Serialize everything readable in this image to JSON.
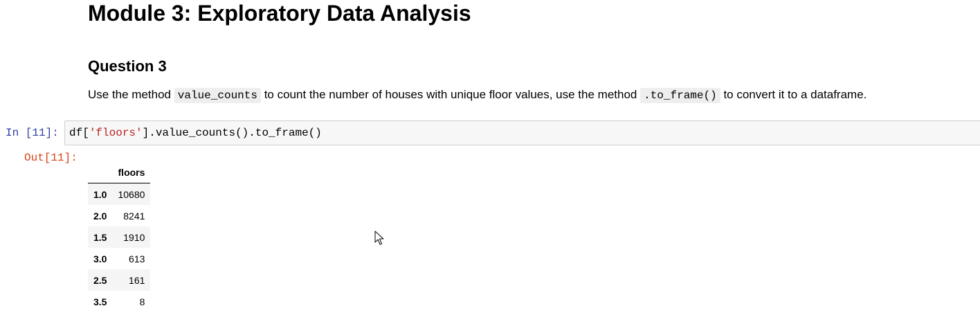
{
  "markdown": {
    "title": "Module 3: Exploratory Data Analysis",
    "question_heading": "Question 3",
    "instruction": {
      "part1": "Use the method ",
      "code1": "value_counts",
      "part2": " to count the number of houses with unique floor values, use the method ",
      "code2": ".to_frame()",
      "part3": " to convert it to a dataframe."
    }
  },
  "code_cell": {
    "prompt": "In [11]:",
    "code_prefix": "df[",
    "code_string": "'floors'",
    "code_suffix": "].value_counts().to_frame()"
  },
  "output_cell": {
    "prompt": "Out[11]:",
    "table": {
      "index_header": "",
      "column_header": "floors",
      "rows": [
        {
          "index": "1.0",
          "value": "10680"
        },
        {
          "index": "2.0",
          "value": "8241"
        },
        {
          "index": "1.5",
          "value": "1910"
        },
        {
          "index": "3.0",
          "value": "613"
        },
        {
          "index": "2.5",
          "value": "161"
        },
        {
          "index": "3.5",
          "value": "8"
        }
      ]
    }
  },
  "icons": {
    "cursor": "mouse-pointer-icon"
  }
}
